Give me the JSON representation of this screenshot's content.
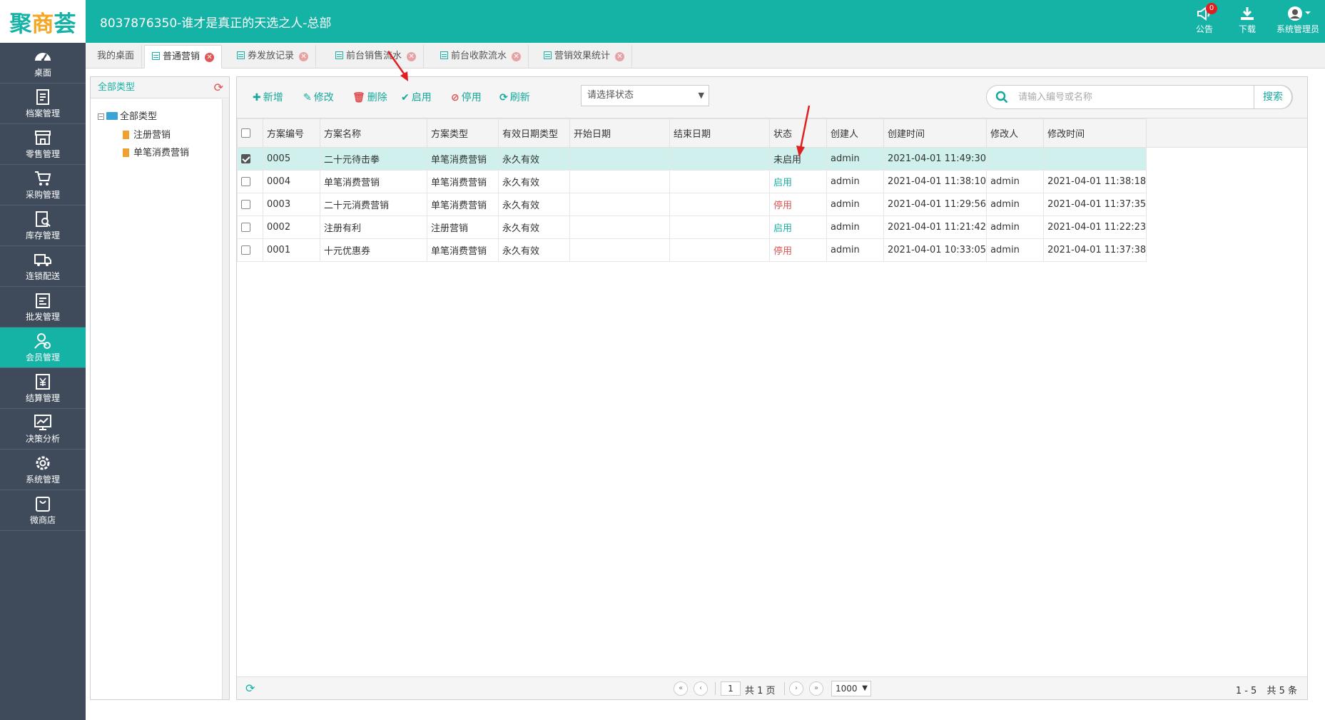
{
  "header": {
    "logo": {
      "left": "聚",
      "mid": "商",
      "right": "荟"
    },
    "title": "8037876350-谁才是真正的天选之人-总部",
    "notice_label": "公告",
    "notice_count": "0",
    "download_label": "下载",
    "user_label": "系统管理员"
  },
  "sidebar": {
    "items": [
      {
        "label": "桌面",
        "icon": "dashboard-icon"
      },
      {
        "label": "档案管理",
        "icon": "archive-icon"
      },
      {
        "label": "零售管理",
        "icon": "store-icon"
      },
      {
        "label": "采购管理",
        "icon": "cart-icon"
      },
      {
        "label": "库存管理",
        "icon": "inventory-icon"
      },
      {
        "label": "连锁配送",
        "icon": "truck-icon"
      },
      {
        "label": "批发管理",
        "icon": "wholesale-icon"
      },
      {
        "label": "会员管理",
        "icon": "member-icon"
      },
      {
        "label": "结算管理",
        "icon": "settlement-icon"
      },
      {
        "label": "决策分析",
        "icon": "analysis-icon"
      },
      {
        "label": "系统管理",
        "icon": "gear-icon"
      },
      {
        "label": "微商店",
        "icon": "shop-bag-icon"
      }
    ]
  },
  "tabs": [
    {
      "label": "我的桌面"
    },
    {
      "label": "普通营销"
    },
    {
      "label": "券发放记录"
    },
    {
      "label": "前台销售流水"
    },
    {
      "label": "前台收款流水"
    },
    {
      "label": "营销效果统计"
    }
  ],
  "tree": {
    "header": "全部类型",
    "root": "全部类型",
    "children": [
      "注册营销",
      "单笔消费营销"
    ]
  },
  "toolbar": {
    "add": "新增",
    "edit": "修改",
    "delete": "删除",
    "enable": "启用",
    "disable": "停用",
    "refresh": "刷新",
    "status_placeholder": "请选择状态",
    "search_placeholder": "请输入编号或名称",
    "search_button": "搜索"
  },
  "table": {
    "columns": [
      "方案编号",
      "方案名称",
      "方案类型",
      "有效日期类型",
      "开始日期",
      "结束日期",
      "状态",
      "创建人",
      "创建时间",
      "修改人",
      "修改时间"
    ],
    "rows": [
      {
        "id": "0005",
        "name": "二十元待击拳",
        "type": "单笔消费营销",
        "date_type": "永久有效",
        "start": "",
        "end": "",
        "status": "未启用",
        "status_kind": "none",
        "creator": "admin",
        "created": "2021-04-01 11:49:30",
        "modifier": "",
        "modified": "",
        "checked": true
      },
      {
        "id": "0004",
        "name": "单笔消费营销",
        "type": "单笔消费营销",
        "date_type": "永久有效",
        "start": "",
        "end": "",
        "status": "启用",
        "status_kind": "on",
        "creator": "admin",
        "created": "2021-04-01 11:38:10",
        "modifier": "admin",
        "modified": "2021-04-01 11:38:18",
        "checked": false
      },
      {
        "id": "0003",
        "name": "二十元消费营销",
        "type": "单笔消费营销",
        "date_type": "永久有效",
        "start": "",
        "end": "",
        "status": "停用",
        "status_kind": "off",
        "creator": "admin",
        "created": "2021-04-01 11:29:56",
        "modifier": "admin",
        "modified": "2021-04-01 11:37:35",
        "checked": false
      },
      {
        "id": "0002",
        "name": "注册有利",
        "type": "注册营销",
        "date_type": "永久有效",
        "start": "",
        "end": "",
        "status": "启用",
        "status_kind": "on",
        "creator": "admin",
        "created": "2021-04-01 11:21:42",
        "modifier": "admin",
        "modified": "2021-04-01 11:22:23",
        "checked": false
      },
      {
        "id": "0001",
        "name": "十元优惠券",
        "type": "单笔消费营销",
        "date_type": "永久有效",
        "start": "",
        "end": "",
        "status": "停用",
        "status_kind": "off",
        "creator": "admin",
        "created": "2021-04-01 10:33:05",
        "modifier": "admin",
        "modified": "2021-04-01 11:37:38",
        "checked": false
      }
    ]
  },
  "pager": {
    "page": "1",
    "total_pages": "共 1 页",
    "page_size": "1000",
    "range": "1 - 5",
    "total": "共 5 条"
  },
  "colors": {
    "brand": "#15b2a6",
    "sidebar": "#3f4b5a",
    "danger": "#e05555",
    "annotation": "#e02020"
  }
}
